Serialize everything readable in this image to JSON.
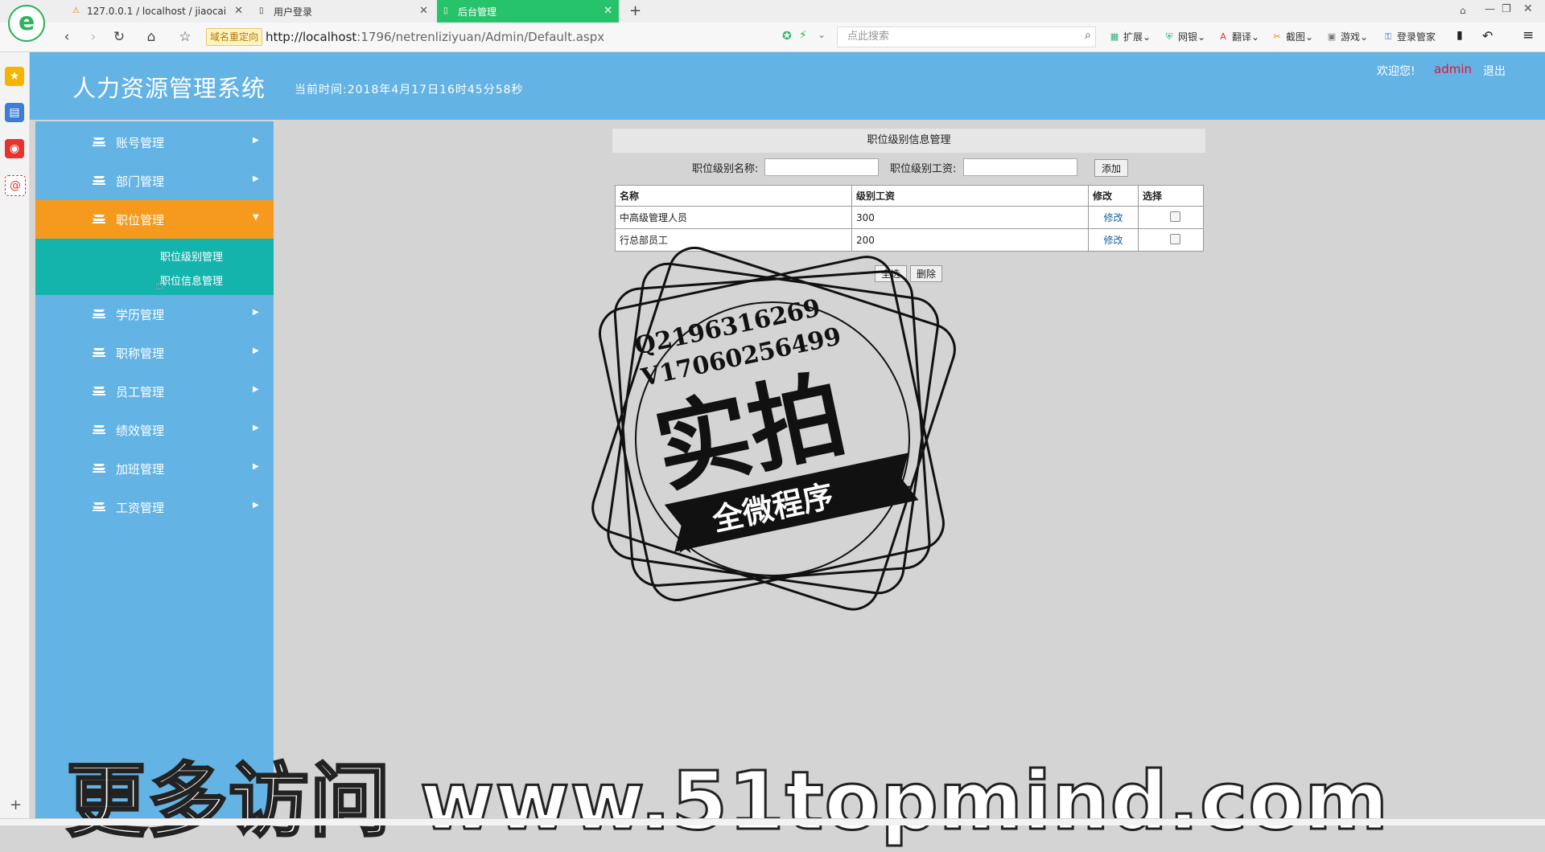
{
  "browser": {
    "tabs": [
      {
        "title": "127.0.0.1 / localhost / jiaocai",
        "icon": "phpmyadmin-icon"
      },
      {
        "title": "用户登录",
        "icon": "page-icon"
      },
      {
        "title": "后台管理",
        "icon": "page-icon",
        "active": true
      }
    ],
    "redirect_badge": "域名重定向",
    "url_host": "http://localhost",
    "url_path": ":1796/netrenliziyuan/Admin/Default.aspx",
    "search_placeholder": "点此搜索",
    "toolbar": [
      "扩展",
      "网银",
      "翻译",
      "截图",
      "游戏",
      "登录管家"
    ]
  },
  "header": {
    "title": "人力资源管理系统",
    "time": "当前时间:2018年4月17日16时45分58秒",
    "welcome": "欢迎您!",
    "user": "admin",
    "logout": "退出"
  },
  "sidebar": {
    "items": [
      {
        "label": "账号管理"
      },
      {
        "label": "部门管理"
      },
      {
        "label": "职位管理",
        "active": true
      },
      {
        "label": "学历管理"
      },
      {
        "label": "职称管理"
      },
      {
        "label": "员工管理"
      },
      {
        "label": "绩效管理"
      },
      {
        "label": "加班管理"
      },
      {
        "label": "工资管理"
      }
    ],
    "submenu": [
      "职位级别管理",
      "职位信息管理"
    ]
  },
  "panel": {
    "title": "职位级别信息管理",
    "name_label": "职位级别名称:",
    "salary_label": "职位级别工资:",
    "name_value": "",
    "salary_value": "",
    "add_button": "添加",
    "table": {
      "headers": [
        "名称",
        "级别工资",
        "修改",
        "选择"
      ],
      "rows": [
        {
          "name": "中高级管理人员",
          "salary": "300",
          "edit": "修改"
        },
        {
          "name": "行总部员工",
          "salary": "200",
          "edit": "修改"
        }
      ]
    },
    "select_all_button": "全选",
    "delete_button": "删除"
  },
  "watermark": {
    "contact_q": "Q2196316269",
    "contact_v": "V17060256499",
    "stamp_main": "实拍",
    "stamp_sub": "全微程序",
    "bottom": "更多访问 www.51topmind.com"
  },
  "colors": {
    "header_blue": "#63b3e5",
    "active_orange": "#f59a1c",
    "submenu_teal": "#14b4ad",
    "admin_red": "#e8112d"
  }
}
